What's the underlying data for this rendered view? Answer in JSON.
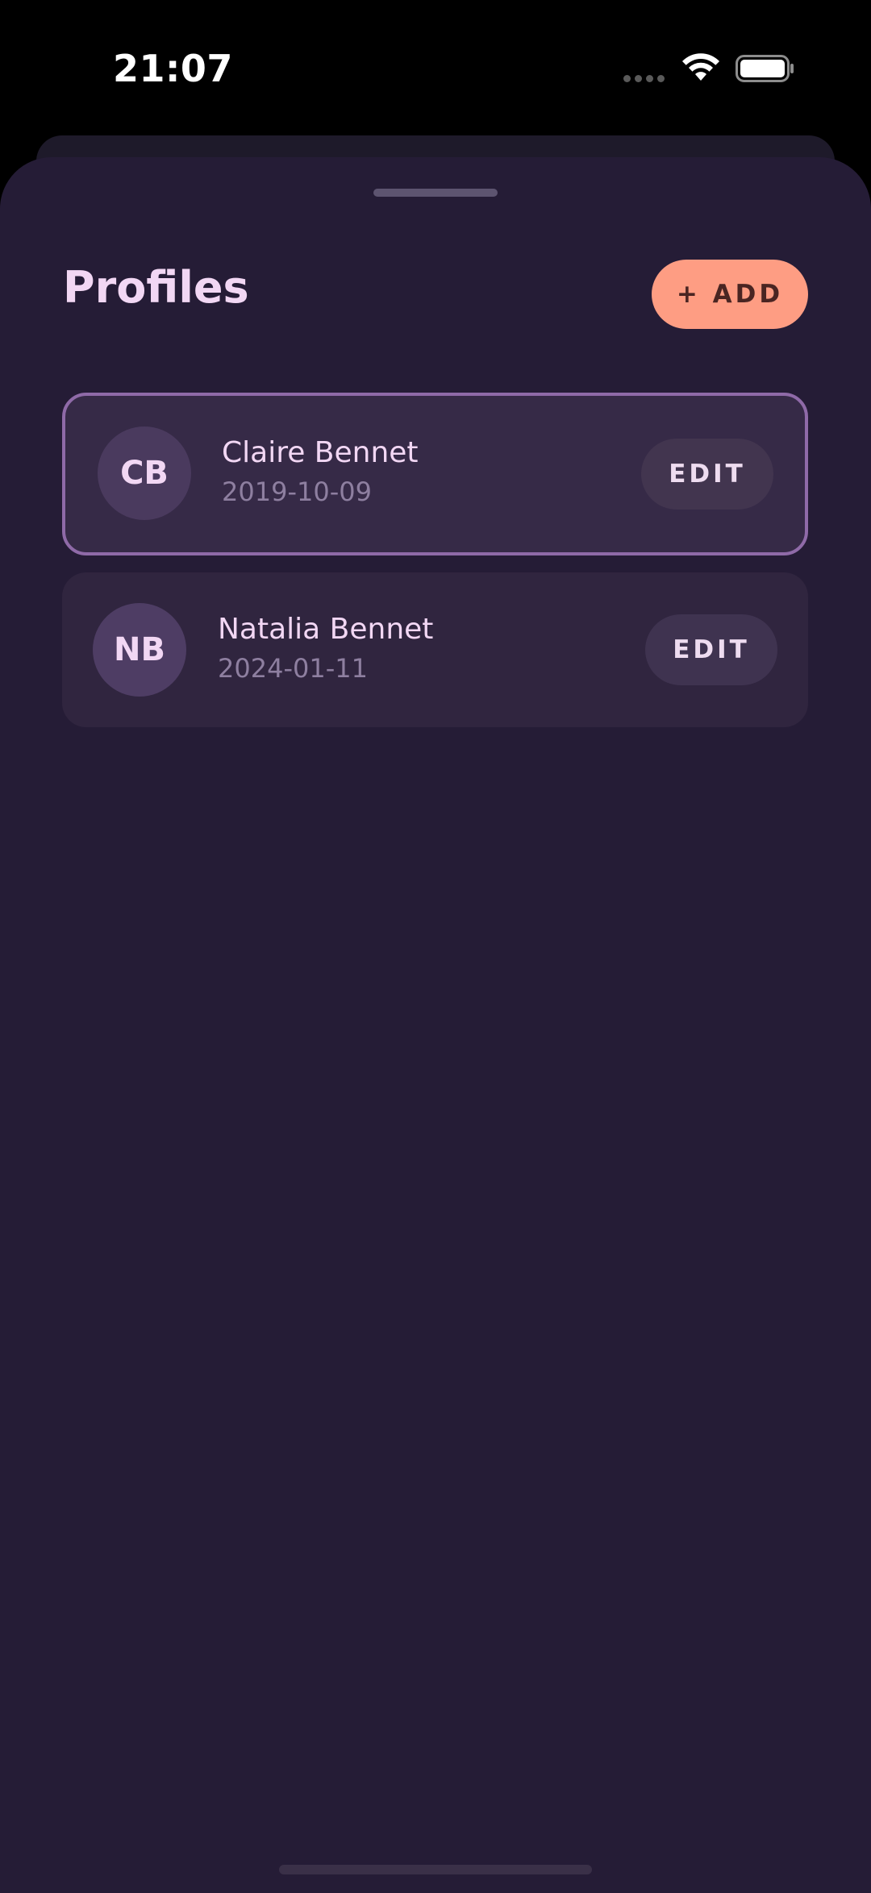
{
  "status_bar": {
    "time": "21:07"
  },
  "sheet": {
    "title": "Profiles",
    "add_button_label": "+ ADD"
  },
  "profiles": [
    {
      "initials": "CB",
      "name": "Claire Bennet",
      "date": "2019-10-09",
      "edit_label": "EDIT",
      "selected": true
    },
    {
      "initials": "NB",
      "name": "Natalia Bennet",
      "date": "2024-01-11",
      "edit_label": "EDIT",
      "selected": false
    }
  ],
  "icons": {
    "wifi": "wifi-icon",
    "battery": "battery-icon",
    "signal": "signal-icon"
  },
  "colors": {
    "sheet_background": "#251c36",
    "accent": "#fe9d83",
    "selected_border": "#8f6aa8",
    "title_text": "#f2d7f4"
  }
}
